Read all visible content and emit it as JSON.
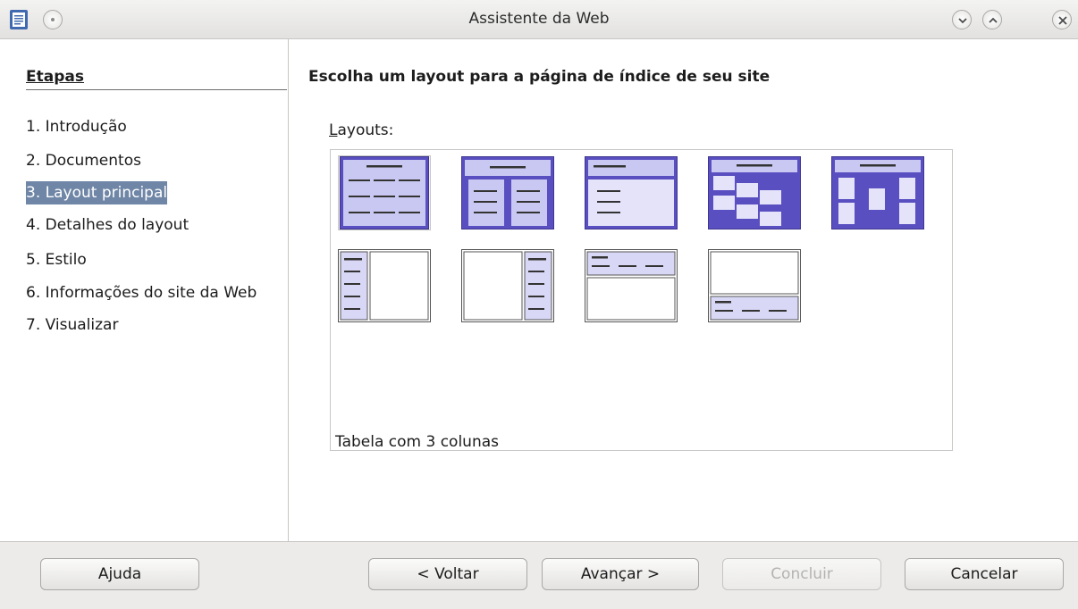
{
  "window": {
    "title": "Assistente da Web"
  },
  "sidebar": {
    "title": "Etapas",
    "steps": [
      {
        "label": "1. Introdução",
        "active": false
      },
      {
        "label": "2. Documentos",
        "active": false
      },
      {
        "label": "3. Layout principal",
        "active": true
      },
      {
        "label": "4. Detalhes do layout",
        "active": false
      },
      {
        "label": "5. Estilo",
        "active": false
      },
      {
        "label": "6. Informações do site da Web",
        "active": false
      },
      {
        "label": "7. Visualizar",
        "active": false
      }
    ]
  },
  "main": {
    "title": "Escolha um layout para a página de índice de seu site",
    "layouts_label": "Layouts:",
    "selected_caption": "Tabela com 3 colunas",
    "layouts": [
      {
        "name": "table-3-columns",
        "selected": true
      },
      {
        "name": "table-2-columns",
        "selected": false
      },
      {
        "name": "simple",
        "selected": false
      },
      {
        "name": "diagonal",
        "selected": false
      },
      {
        "name": "zigzag",
        "selected": false
      },
      {
        "name": "frame-left",
        "selected": false
      },
      {
        "name": "frame-right",
        "selected": false
      },
      {
        "name": "frame-top",
        "selected": false
      },
      {
        "name": "frame-bottom",
        "selected": false
      }
    ]
  },
  "footer": {
    "help": "Ajuda",
    "back": "< Voltar",
    "next": "Avançar >",
    "finish": "Concluir",
    "cancel": "Cancelar"
  },
  "colors": {
    "accent": "#6f86a6",
    "thumb_purple": "#5a4fc0",
    "thumb_light": "#c9c8f2"
  }
}
